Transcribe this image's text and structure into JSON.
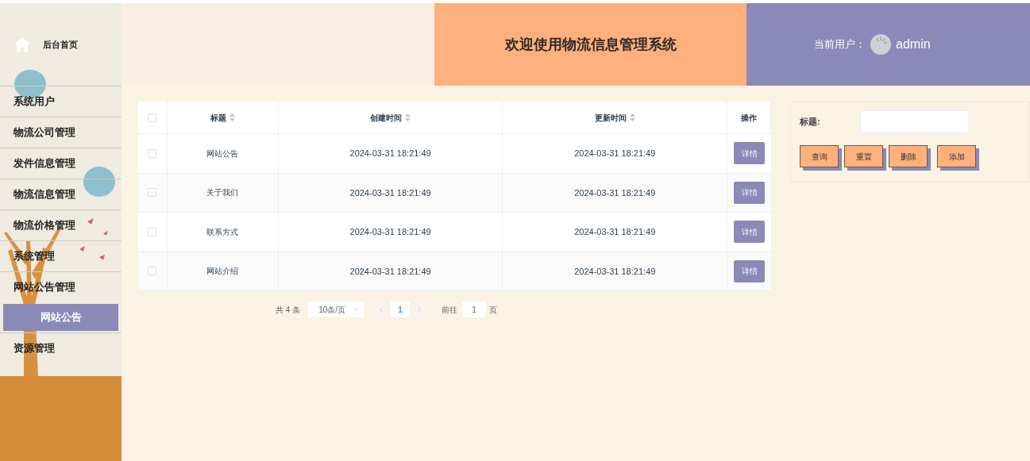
{
  "sidebar": {
    "home": "后台首页",
    "items": [
      {
        "label": "系统用户",
        "selected": false
      },
      {
        "label": "物流公司管理",
        "selected": false
      },
      {
        "label": "发件信息管理",
        "selected": false
      },
      {
        "label": "物流信息管理",
        "selected": false
      },
      {
        "label": "物流价格管理",
        "selected": false
      },
      {
        "label": "系统管理",
        "selected": false
      },
      {
        "label": "网站公告管理",
        "selected": false,
        "children": [
          {
            "label": "网站公告",
            "selected": true
          }
        ]
      },
      {
        "label": "资源管理",
        "selected": false
      }
    ]
  },
  "header": {
    "title": "欢迎使用物流信息管理系统",
    "user_label": "当前用户：",
    "username": "admin"
  },
  "table": {
    "select_all_checked": false,
    "columns": [
      {
        "label": "标题",
        "sortable": true
      },
      {
        "label": "创建时间",
        "sortable": true
      },
      {
        "label": "更新时间",
        "sortable": true
      },
      {
        "label": "操作",
        "sortable": false
      }
    ],
    "rows": [
      {
        "checked": false,
        "title": "网站公告",
        "created": "2024-03-31 18:21:49",
        "updated": "2024-03-31 18:21:49",
        "action": "详情"
      },
      {
        "checked": false,
        "title": "关于我们",
        "created": "2024-03-31 18:21:49",
        "updated": "2024-03-31 18:21:49",
        "action": "详情"
      },
      {
        "checked": false,
        "title": "联系方式",
        "created": "2024-03-31 18:21:49",
        "updated": "2024-03-31 18:21:49",
        "action": "详情"
      },
      {
        "checked": false,
        "title": "网站介绍",
        "created": "2024-03-31 18:21:49",
        "updated": "2024-03-31 18:21:49",
        "action": "详情"
      }
    ]
  },
  "pagination": {
    "total": "共 4 条",
    "page_size": "10条/页",
    "pages": [
      {
        "label": "1",
        "selected": true
      }
    ],
    "goto_label": "前往",
    "goto_value": "1",
    "goto_suffix": "页"
  },
  "search": {
    "label": "标题:",
    "buttons": [
      "查询",
      "重置",
      "删除",
      "添加"
    ]
  }
}
